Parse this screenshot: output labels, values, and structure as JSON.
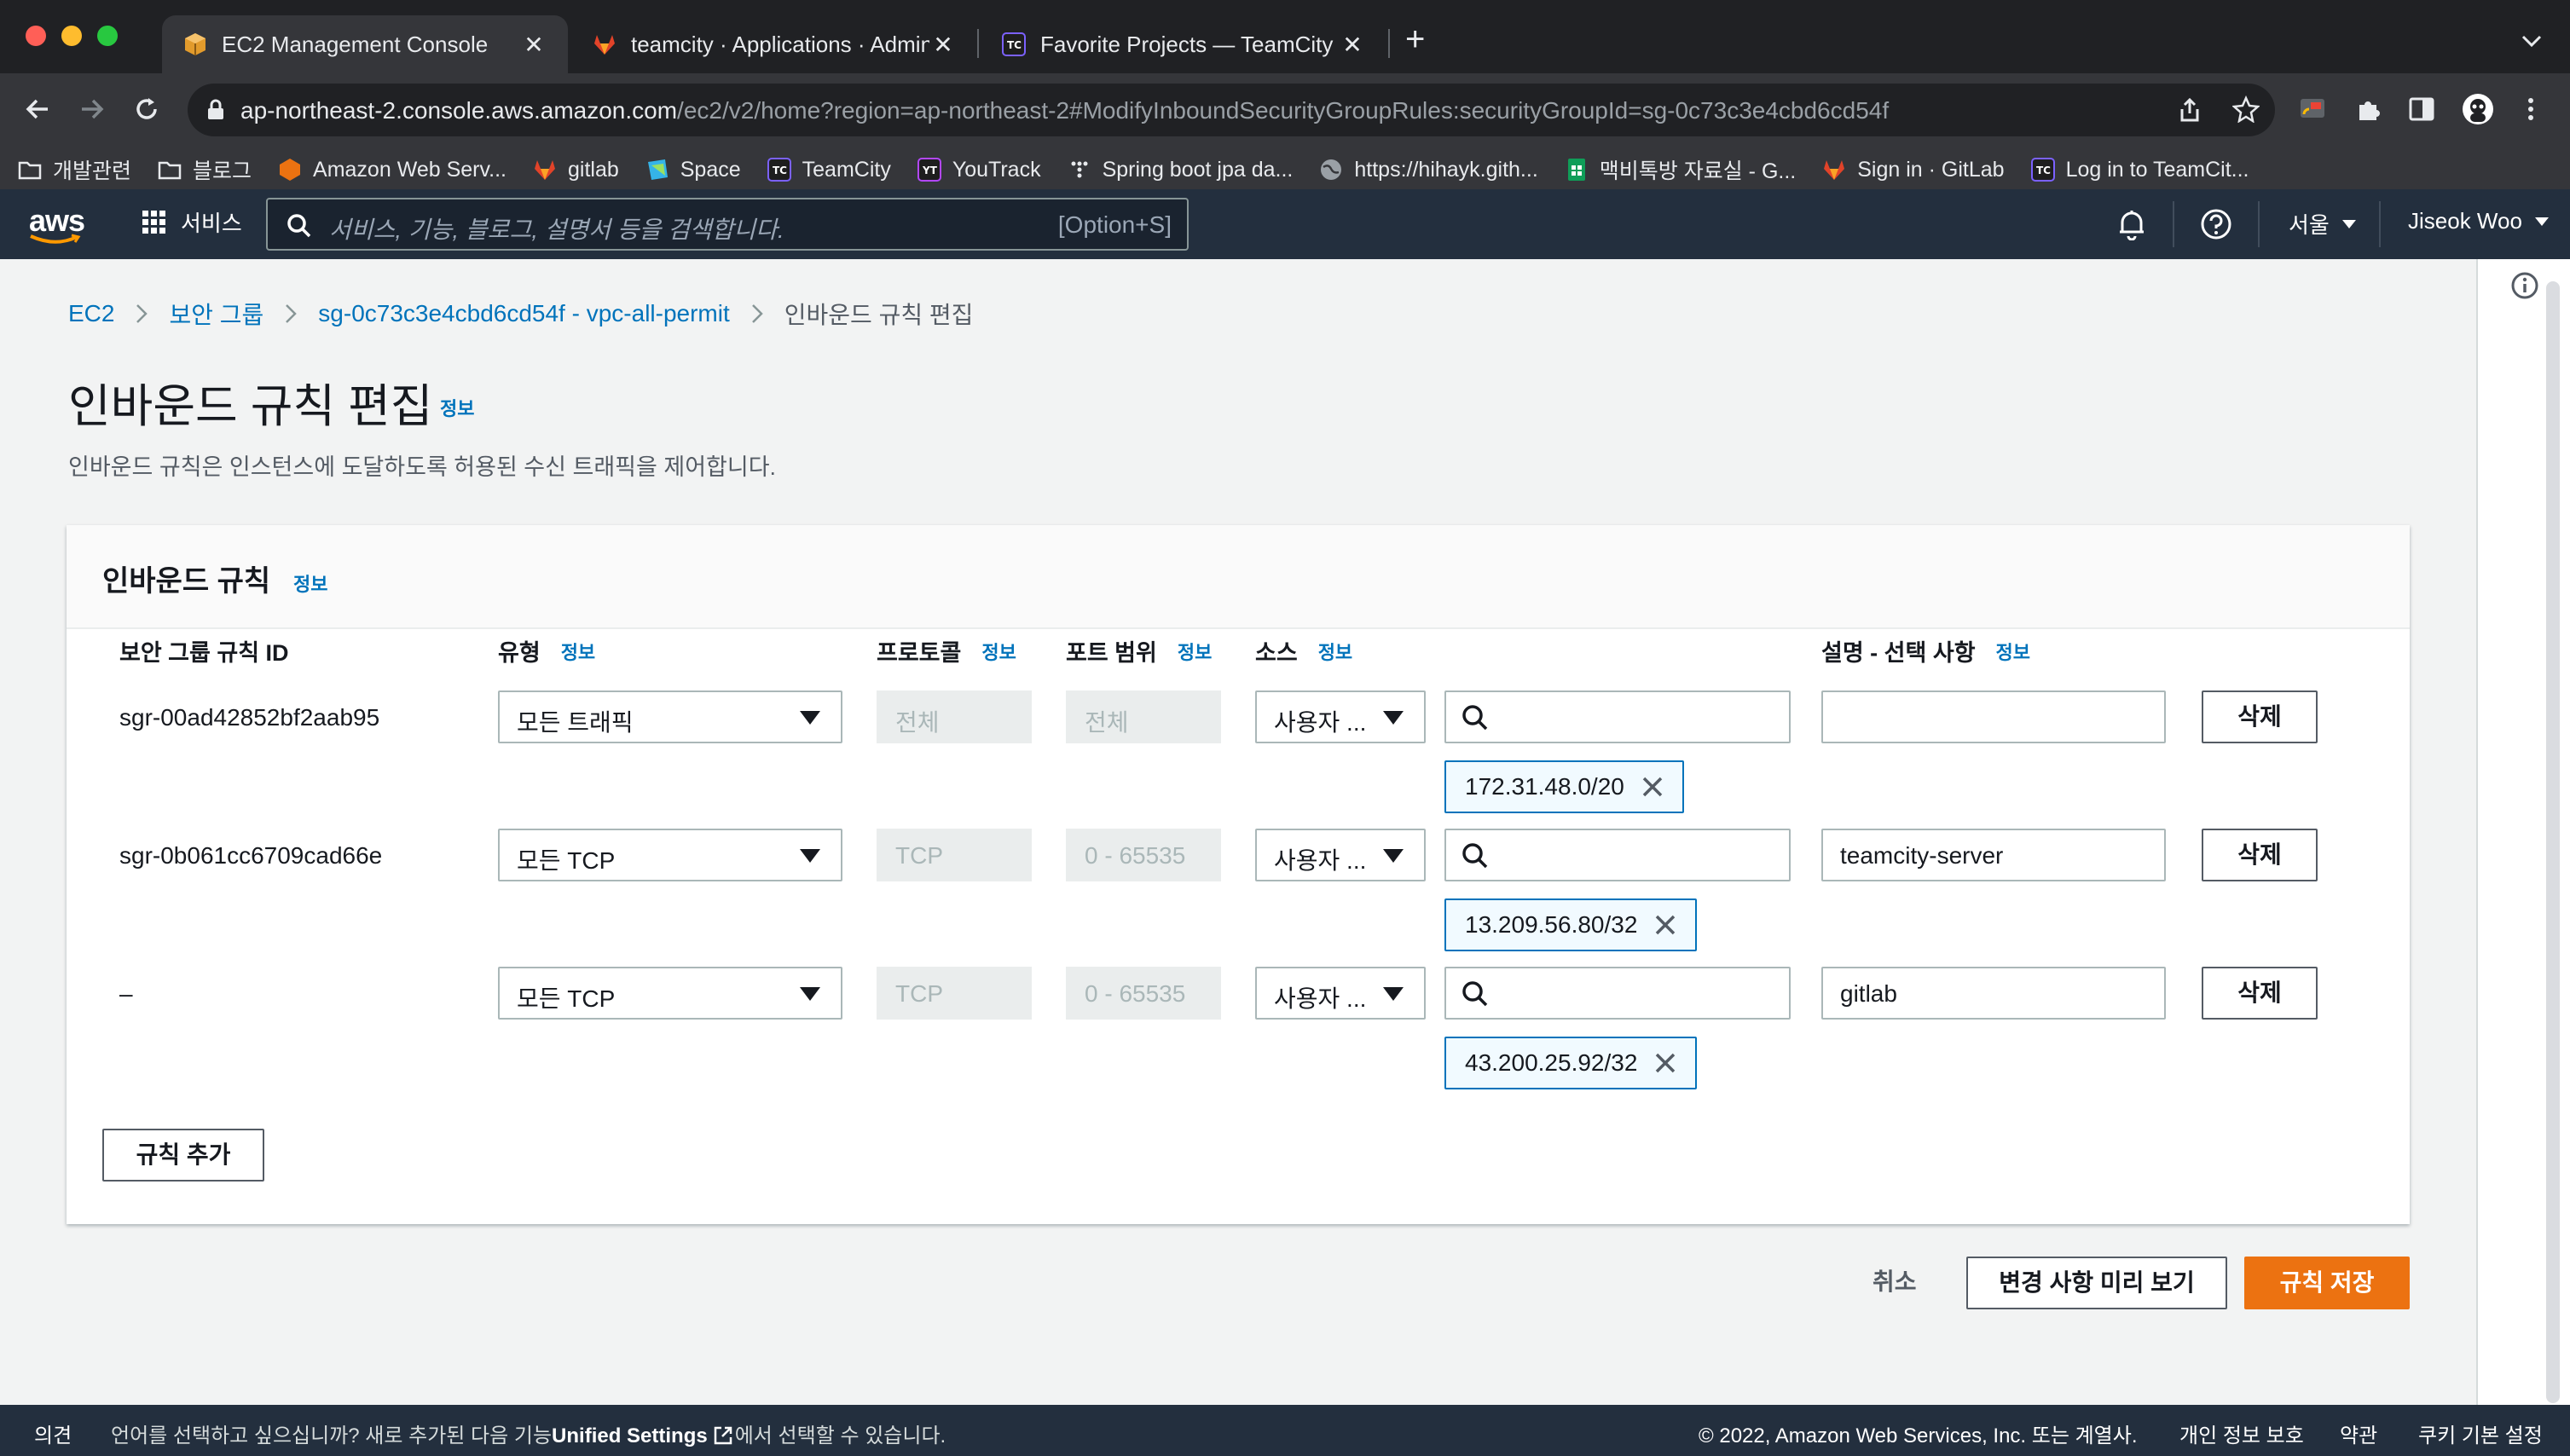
{
  "browser": {
    "tabs": [
      {
        "title": "EC2 Management Console",
        "active": true,
        "favicon": "aws-cube-icon"
      },
      {
        "title": "teamcity · Applications · Admin",
        "active": false,
        "favicon": "gitlab-fox-icon"
      },
      {
        "title": "Favorite Projects — TeamCity",
        "active": false,
        "favicon": "teamcity-icon"
      }
    ],
    "new_tab_symbol": "+",
    "close_symbol": "✕",
    "url_host": "ap-northeast-2.console.aws.amazon.com",
    "url_path": "/ec2/v2/home?region=ap-northeast-2#ModifyInboundSecurityGroupRules:securityGroupId=sg-0c73c3e4cbd6cd54f",
    "bookmarks": [
      {
        "label": "개발관련",
        "icon": "folder-icon"
      },
      {
        "label": "블로그",
        "icon": "folder-icon"
      },
      {
        "label": "Amazon Web Serv...",
        "icon": "aws-icon"
      },
      {
        "label": "gitlab",
        "icon": "gitlab-icon"
      },
      {
        "label": "Space",
        "icon": "space-icon"
      },
      {
        "label": "TeamCity",
        "icon": "teamcity-icon"
      },
      {
        "label": "YouTrack",
        "icon": "youtrack-icon"
      },
      {
        "label": "Spring boot jpa da...",
        "icon": "dots-icon"
      },
      {
        "label": "https://hihayk.gith...",
        "icon": "globe-icon"
      },
      {
        "label": "맥비톡방 자료실 - G...",
        "icon": "sheets-icon"
      },
      {
        "label": "Sign in · GitLab",
        "icon": "gitlab-icon"
      },
      {
        "label": "Log in to TeamCit...",
        "icon": "teamcity-icon"
      }
    ]
  },
  "aws_header": {
    "logo": "aws",
    "services_label": "서비스",
    "search_placeholder": "서비스, 기능, 블로그, 설명서 등을 검색합니다.",
    "search_shortcut": "[Option+S]",
    "region": "서울",
    "user": "Jiseok Woo"
  },
  "breadcrumb": {
    "items": [
      "EC2",
      "보안 그룹",
      "sg-0c73c3e4cbd6cd54f - vpc-all-permit"
    ],
    "current": "인바운드 규칙 편집"
  },
  "page": {
    "title": "인바운드 규칙 편집",
    "info": "정보",
    "description": "인바운드 규칙은 인스턴스에 도달하도록 허용된 수신 트래픽을 제어합니다."
  },
  "panel": {
    "title": "인바운드 규칙",
    "info": "정보",
    "columns": {
      "rule_id": "보안 그룹 규칙 ID",
      "type": "유형",
      "protocol": "프로토콜",
      "port_range": "포트 범위",
      "source": "소스",
      "description": "설명 - 선택 사항"
    },
    "rows": [
      {
        "rule_id": "sgr-00ad42852bf2aab95",
        "type": "모든 트래픽",
        "protocol": "전체",
        "port_range": "전체",
        "source_type": "사용자 ...",
        "cidr": "172.31.48.0/20",
        "description": ""
      },
      {
        "rule_id": "sgr-0b061cc6709cad66e",
        "type": "모든 TCP",
        "protocol": "TCP",
        "port_range": "0 - 65535",
        "source_type": "사용자 ...",
        "cidr": "13.209.56.80/32",
        "description": "teamcity-server"
      },
      {
        "rule_id": "–",
        "type": "모든 TCP",
        "protocol": "TCP",
        "port_range": "0 - 65535",
        "source_type": "사용자 ...",
        "cidr": "43.200.25.92/32",
        "description": "gitlab"
      }
    ],
    "delete_label": "삭제",
    "add_rule_label": "규칙 추가"
  },
  "actions": {
    "cancel": "취소",
    "preview": "변경 사항 미리 보기",
    "save": "규칙 저장"
  },
  "footer": {
    "feedback": "의견",
    "lang_prefix": "언어를 선택하고 싶으십니까? 새로 추가된 다음 기능",
    "unified_settings": "Unified Settings",
    "lang_suffix": "에서 선택할 수 있습니다.",
    "copyright": "© 2022, Amazon Web Services, Inc. 또는 계열사.",
    "privacy": "개인 정보 보호",
    "terms": "약관",
    "cookies": "쿠키 기본 설정"
  },
  "colors": {
    "aws_nav": "#232f3e",
    "link": "#0073bb",
    "primary": "#ec7211"
  }
}
